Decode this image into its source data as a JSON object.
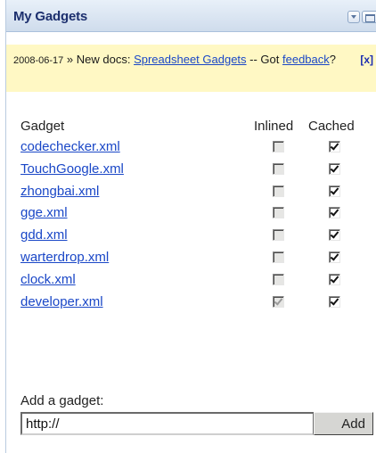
{
  "panel": {
    "title": "My Gadgets"
  },
  "news": {
    "date": "2008-06-17",
    "separator": " » ",
    "prefix": "New docs: ",
    "link_label": "Spreadsheet Gadgets",
    "middle": " -- Got ",
    "feedback_label": "feedback",
    "suffix": "?",
    "close_label": "[x]"
  },
  "table": {
    "headers": {
      "gadget": "Gadget",
      "inlined": "Inlined",
      "cached": "Cached"
    },
    "rows": [
      {
        "name": "codechecker.xml",
        "inlined": false,
        "inlined_disabled": true,
        "cached": true
      },
      {
        "name": "TouchGoogle.xml",
        "inlined": false,
        "inlined_disabled": true,
        "cached": true
      },
      {
        "name": "zhongbai.xml",
        "inlined": false,
        "inlined_disabled": true,
        "cached": true
      },
      {
        "name": "gge.xml",
        "inlined": false,
        "inlined_disabled": true,
        "cached": true
      },
      {
        "name": "gdd.xml",
        "inlined": false,
        "inlined_disabled": true,
        "cached": true
      },
      {
        "name": "warterdrop.xml",
        "inlined": false,
        "inlined_disabled": true,
        "cached": true
      },
      {
        "name": "clock.xml",
        "inlined": false,
        "inlined_disabled": true,
        "cached": true
      },
      {
        "name": "developer.xml",
        "inlined": true,
        "inlined_disabled": true,
        "cached": true
      }
    ]
  },
  "add": {
    "label": "Add a gadget:",
    "input_value": "http://",
    "button_label": "Add"
  },
  "colors": {
    "title_text": "#1c2f6e",
    "link": "#1a47c7",
    "news_bg": "#fff8c4"
  }
}
